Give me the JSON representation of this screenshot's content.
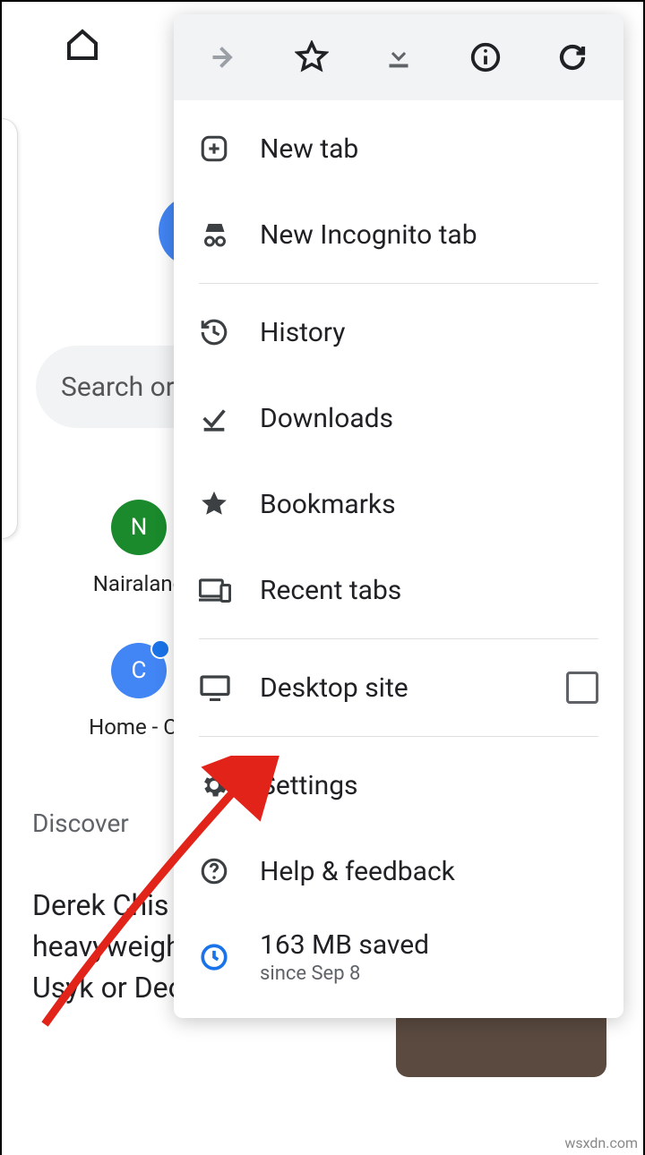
{
  "topbar": {
    "home_icon": "home-icon"
  },
  "menu": {
    "icon_row": {
      "forward": "forward-icon",
      "bookmark": "star-outline-icon",
      "download": "download-icon",
      "info": "info-icon",
      "reload": "reload-icon"
    },
    "items": {
      "new_tab": "New tab",
      "incognito": "New Incognito tab",
      "history": "History",
      "downloads": "Downloads",
      "bookmarks": "Bookmarks",
      "recent_tabs": "Recent tabs",
      "desktop_site": "Desktop site",
      "settings": "Settings",
      "help": "Help & feedback",
      "data_saved_primary": "163 MB saved",
      "data_saved_secondary": "since Sep 8"
    }
  },
  "background": {
    "search_placeholder": "Search or",
    "shortcuts": [
      {
        "letter": "N",
        "label": "Nairaland",
        "color": "#1a8a2c"
      },
      {
        "letter": "C",
        "label": "Home - Ca",
        "color": "#4285f4"
      }
    ],
    "discover_label": "Discover",
    "article_headline": "Derek Chis 'mental' lis five heavyweights no Oleksandr Usyk or Deontay Wilder"
  },
  "watermark": "wsxdn.com"
}
